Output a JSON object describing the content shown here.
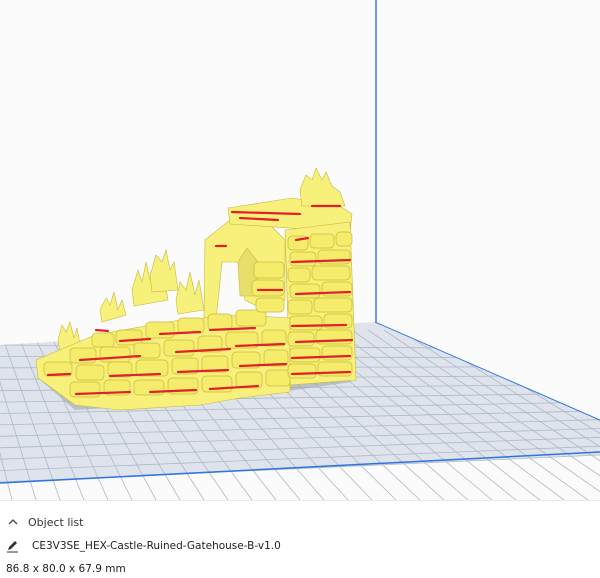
{
  "object_list": {
    "header_label": "Object list",
    "object_name": "CE3V3SE_HEX-Castle-Ruined-Gatehouse-B-v1.0",
    "dimensions": "86.8 x 80.0 x 67.9 mm"
  },
  "colors": {
    "model": "#f7f07a",
    "overhang": "#e0202a",
    "build_plate": "#cdd5e0",
    "grid_line": "#a9b4c4",
    "volume_edge": "#2f74e0"
  },
  "icons": [
    "chevron-up-icon",
    "pencil-icon"
  ]
}
